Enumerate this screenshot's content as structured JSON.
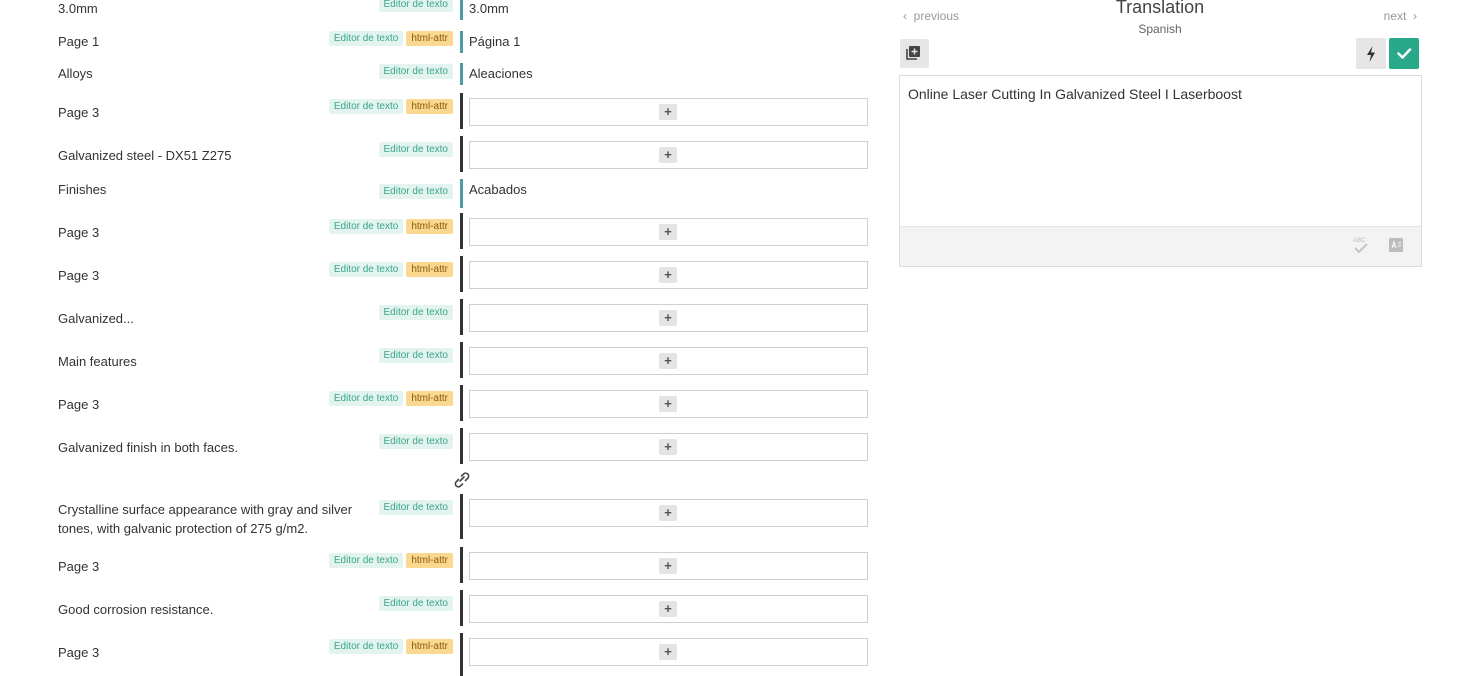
{
  "rows": [
    {
      "source": "3.0mm",
      "tags": [
        "Editor de texto"
      ],
      "translation": "3.0mm",
      "status": "teal"
    },
    {
      "source": "Page 1",
      "tags": [
        "Editor de texto",
        "html-attr"
      ],
      "translation": "Página 1",
      "status": "teal"
    },
    {
      "source": "Alloys",
      "tags": [
        "Editor de texto"
      ],
      "translation": "Aleaciones",
      "status": "teal"
    },
    {
      "source": "Page 3",
      "tags": [
        "Editor de texto",
        "html-attr"
      ],
      "translation": "",
      "status": "dark"
    },
    {
      "source": "Galvanized steel - DX51 Z275",
      "tags": [
        "Editor de texto"
      ],
      "translation": "",
      "status": "dark"
    },
    {
      "source": "Finishes",
      "tags": [
        "Editor de texto"
      ],
      "translation": "Acabados",
      "status": "teal"
    },
    {
      "source": "Page 3",
      "tags": [
        "Editor de texto",
        "html-attr"
      ],
      "translation": "",
      "status": "dark"
    },
    {
      "source": "Page 3",
      "tags": [
        "Editor de texto",
        "html-attr"
      ],
      "translation": "",
      "status": "dark"
    },
    {
      "source": "Galvanized...",
      "tags": [
        "Editor de texto"
      ],
      "translation": "",
      "status": "dark"
    },
    {
      "source": "Main features",
      "tags": [
        "Editor de texto"
      ],
      "translation": "",
      "status": "dark"
    },
    {
      "source": "Page 3",
      "tags": [
        "Editor de texto",
        "html-attr"
      ],
      "translation": "",
      "status": "dark"
    },
    {
      "source": "Galvanized finish in both faces.",
      "tags": [
        "Editor de texto"
      ],
      "translation": "",
      "status": "dark"
    },
    {
      "source": "Crystalline surface appearance with gray and silver tones, with galvanic protection of 275 g/m2.",
      "tags": [
        "Editor de texto"
      ],
      "translation": "",
      "status": "dark"
    },
    {
      "source": "Page 3",
      "tags": [
        "Editor de texto",
        "html-attr"
      ],
      "translation": "",
      "status": "dark"
    },
    {
      "source": "Good corrosion resistance.",
      "tags": [
        "Editor de texto"
      ],
      "translation": "",
      "status": "dark"
    },
    {
      "source": "Page 3",
      "tags": [
        "Editor de texto",
        "html-attr"
      ],
      "translation": "",
      "status": "dark"
    }
  ],
  "add_button_label": "+",
  "panel": {
    "previous": "previous",
    "next": "next",
    "title": "Translation",
    "language": "Spanish",
    "editor_text": "Online Laser Cutting In Galvanized Steel I Laserboost"
  },
  "colors": {
    "accent": "#27a98a",
    "status_teal": "#4e9aa5",
    "tag_editor_bg": "#e3f4ef",
    "tag_html_bg": "#fbd88f"
  }
}
